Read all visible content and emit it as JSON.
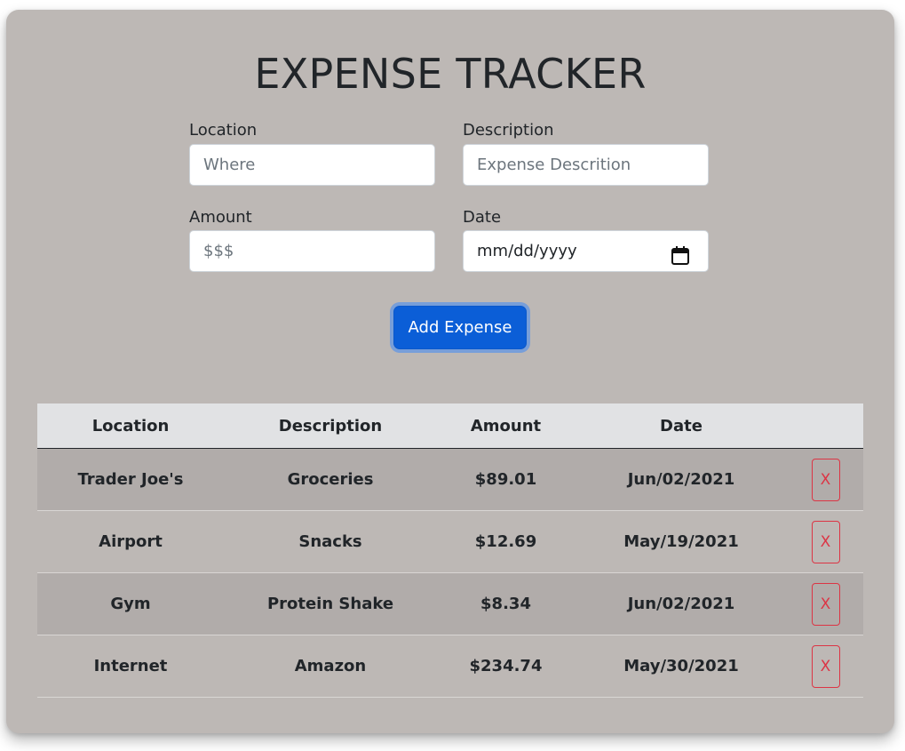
{
  "app": {
    "title": "EXPENSE TRACKER"
  },
  "form": {
    "location": {
      "label": "Location",
      "placeholder": "Where",
      "value": ""
    },
    "description": {
      "label": "Description",
      "placeholder": "Expense Descrition",
      "value": ""
    },
    "amount": {
      "label": "Amount",
      "placeholder": "$$$",
      "value": ""
    },
    "date": {
      "label": "Date",
      "placeholder": "mm/dd/yyyy",
      "icon": "calendar-icon"
    },
    "submit_label": "Add Expense"
  },
  "table": {
    "headers": [
      "Location",
      "Description",
      "Amount",
      "Date",
      ""
    ],
    "rows": [
      {
        "location": "Trader Joe's",
        "description": "Groceries",
        "amount": "$89.01",
        "date": "Jun/02/2021",
        "delete_label": "X"
      },
      {
        "location": "Airport",
        "description": "Snacks",
        "amount": "$12.69",
        "date": "May/19/2021",
        "delete_label": "X"
      },
      {
        "location": "Gym",
        "description": "Protein Shake",
        "amount": "$8.34",
        "date": "Jun/02/2021",
        "delete_label": "X"
      },
      {
        "location": "Internet",
        "description": "Amazon",
        "amount": "$234.74",
        "date": "May/30/2021",
        "delete_label": "X"
      }
    ]
  },
  "colors": {
    "card_background": "#bdb8b5",
    "primary_button": "#0b5ed7",
    "danger": "#dc3545",
    "table_header": "#e1e2e4",
    "striped_row": "#b1acaa"
  }
}
